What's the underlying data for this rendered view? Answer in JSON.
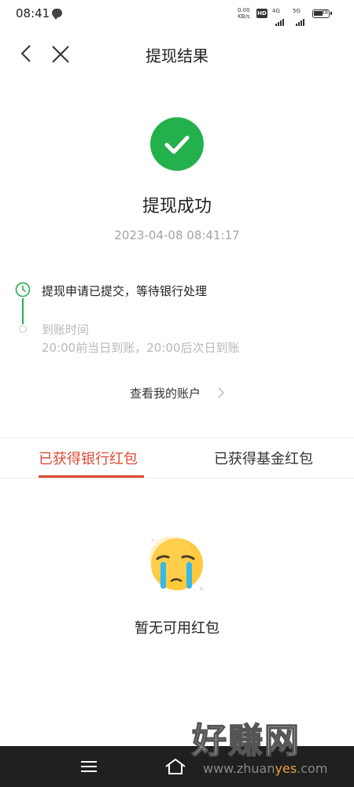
{
  "status_bar": {
    "time": "08:41",
    "speed_value": "0.00",
    "speed_unit": "KB/s",
    "hd": "HD",
    "net1": "4G",
    "net2": "5G",
    "battery": "49"
  },
  "header": {
    "title": "提现结果"
  },
  "result": {
    "title": "提现成功",
    "timestamp": "2023-04-08 08:41:17"
  },
  "timeline": {
    "step1": "提现申请已提交，等待银行处理",
    "step2_title": "到账时间",
    "step2_desc": "20:00前当日到账，20:00后次日到账"
  },
  "account_link": "查看我的账户",
  "tabs": [
    {
      "label": "已获得银行红包",
      "active": true
    },
    {
      "label": "已获得基金红包",
      "active": false
    }
  ],
  "empty_state": {
    "text": "暂无可用红包"
  },
  "watermark": {
    "title": "好赚网",
    "url_a": "www.zhuan",
    "url_b": "yes",
    "url_c": ".com"
  },
  "colors": {
    "success": "#23b14d",
    "accent": "#dc4b32",
    "nav_bg": "#202020"
  }
}
